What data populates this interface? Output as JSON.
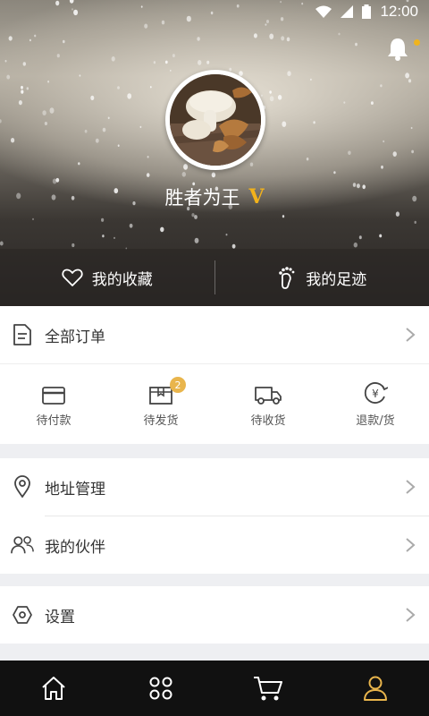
{
  "status_bar": {
    "time": "12:00"
  },
  "profile": {
    "username": "胜者为王",
    "vip_mark": "V"
  },
  "quick_links": [
    {
      "label": "我的收藏",
      "icon": "heart-icon"
    },
    {
      "label": "我的足迹",
      "icon": "footprint-icon"
    }
  ],
  "orders": {
    "title": "全部订单",
    "statuses": [
      {
        "label": "待付款",
        "icon": "card-icon",
        "badge": ""
      },
      {
        "label": "待发货",
        "icon": "box-icon",
        "badge": "2"
      },
      {
        "label": "待收货",
        "icon": "truck-icon",
        "badge": ""
      },
      {
        "label": "退款/货",
        "icon": "refund-yen-icon",
        "badge": ""
      }
    ]
  },
  "menu": {
    "address": "地址管理",
    "partners": "我的伙伴",
    "settings": "设置"
  },
  "bottom_nav": [
    {
      "icon": "home-icon"
    },
    {
      "icon": "category-icon"
    },
    {
      "icon": "cart-icon"
    },
    {
      "icon": "user-icon",
      "active": true
    }
  ],
  "colors": {
    "accent": "#f2b21b",
    "nav_bg": "#111111",
    "active_nav": "#e9b54c"
  }
}
